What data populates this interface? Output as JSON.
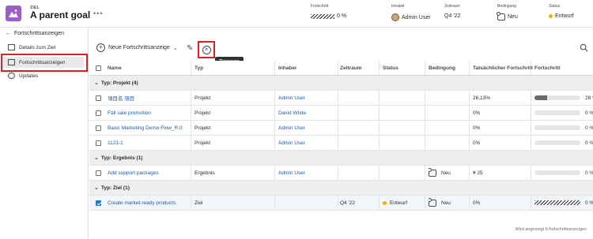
{
  "header": {
    "kicker": "ZIEL",
    "title": "A parent goal",
    "progress_label": "Fortschritt",
    "progress_value": "0 %",
    "progress_percent": 0,
    "owner_label": "Inhaber",
    "owner_value": "Admin User",
    "period_label": "Zeitraum",
    "period_value": "Q4 '22",
    "condition_label": "Bedingung",
    "condition_value": "Neu",
    "status_label": "Status",
    "status_value": "Entwurf",
    "status_color": "#e6b800"
  },
  "sidebar": {
    "items": [
      {
        "label": "Details zum Ziel"
      },
      {
        "label": "Fortschrittsanzeigen"
      },
      {
        "label": "Updates"
      }
    ]
  },
  "toolbar": {
    "add_label": "Neue Fortschrittsanzeige",
    "tooltip": "Trennen"
  },
  "table": {
    "columns": [
      "Name",
      "Typ",
      "Inhaber",
      "Zeitraum",
      "Status",
      "Bedingung",
      "Tatsächlicher Fortschritt",
      "Fortschritt"
    ],
    "groups": [
      {
        "label": "Typ: Projekt (4)",
        "rows": [
          {
            "name": "項目名 項目",
            "type": "Projekt",
            "owner": "Admin User",
            "period": "",
            "status": "",
            "condition": "",
            "actual": "28,13%",
            "progress": "28 %",
            "progress_fraction": 0.28,
            "hatched": false
          },
          {
            "name": "Fall sale promotion",
            "type": "Projekt",
            "owner": "David White",
            "period": "",
            "status": "",
            "condition": "",
            "actual": "0%",
            "progress": "0 %",
            "progress_fraction": 0,
            "hatched": false
          },
          {
            "name": "Basic Marketing Demo Flow_R.0",
            "type": "Projekt",
            "owner": "Admin User",
            "period": "",
            "status": "",
            "condition": "",
            "actual": "0%",
            "progress": "0 %",
            "progress_fraction": 0,
            "hatched": false
          },
          {
            "name": "1121-1",
            "type": "Projekt",
            "owner": "Admin User",
            "period": "",
            "status": "",
            "condition": "",
            "actual": "0%",
            "progress": "0 %",
            "progress_fraction": 0,
            "hatched": false
          }
        ]
      },
      {
        "label": "Typ: Ergebnis (1)",
        "rows": [
          {
            "name": "Add support packages",
            "type": "Ergebnis",
            "owner": "Admin User",
            "period": "",
            "status": "",
            "condition": "Neu",
            "actual": "¥ 25",
            "progress": "0 %",
            "progress_fraction": 0,
            "hatched": false
          }
        ]
      },
      {
        "label": "Typ: Ziel (1)",
        "rows": [
          {
            "name": "Create market-ready products",
            "type": "Ziel",
            "owner": "",
            "period": "Q4 '22",
            "status": "Entwurf",
            "condition": "Neu",
            "actual": "0%",
            "progress": "0 %",
            "progress_fraction": 0,
            "hatched": true,
            "selected": true
          }
        ]
      }
    ]
  },
  "footer": {
    "text": "Wird angezeigt 6 fortschrittsanzeigen"
  }
}
